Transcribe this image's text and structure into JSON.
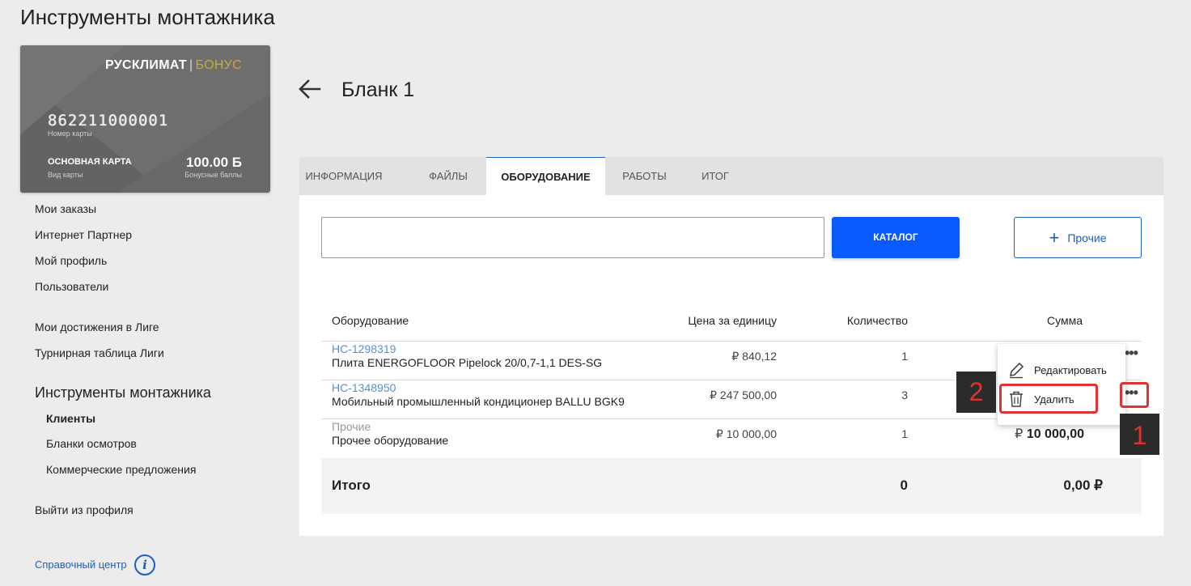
{
  "page_title": "Инструменты монтажника",
  "card": {
    "brand": "РУСКЛИМАТ",
    "brand_sep": "|",
    "brand_bonus": "БОНУС",
    "number": "862211000001",
    "number_label": "Номер карты",
    "type": "ОСНОВНАЯ КАРТА",
    "type_label": "Вид карты",
    "points": "100.00 Б",
    "points_label": "Бонусные баллы"
  },
  "sidebar": {
    "links": [
      "Мои заказы",
      "Интернет Партнер",
      "Мой профиль",
      "Пользователи",
      "Мои достижения в Лиге",
      "Турнирная таблица Лиги"
    ],
    "section_heading": "Инструменты монтажника",
    "sub_items": [
      "Клиенты",
      "Бланки осмотров",
      "Коммерческие предложения"
    ],
    "logout": "Выйти из профиля",
    "help": "Справочный центр",
    "help_icon": "i"
  },
  "header": {
    "title": "Бланк 1"
  },
  "tabs": [
    "ИНФОРМАЦИЯ",
    "ФАЙЛЫ",
    "ОБОРУДОВАНИЕ",
    "РАБОТЫ",
    "ИТОГ"
  ],
  "toolbar": {
    "search_value": "",
    "catalog_label": "КАТАЛОГ",
    "other_label": "Прочие",
    "other_icon": "+"
  },
  "table": {
    "headers": [
      "Оборудование",
      "Цена за единицу",
      "Количество",
      "Сумма"
    ],
    "rows": [
      {
        "code": "HC-1298319",
        "name": "Плита ENERGOFLOOR Pipelock 20/0,7-1,1 DES-SG",
        "price": "₽ 840,12",
        "qty": "1",
        "sum": ""
      },
      {
        "code": "HC-1348950",
        "name": "Мобильный промышленный кондиционер BALLU BGK9",
        "price": "₽ 247 500,00",
        "qty": "3",
        "sum": ""
      },
      {
        "code": "Прочие",
        "name": "Прочее оборудование",
        "price": "₽ 10 000,00",
        "qty": "1",
        "sum": "10 000,00",
        "sum_currency": "₽"
      }
    ],
    "row_menu_icon": "•••",
    "total": {
      "label": "Итого",
      "qty": "0",
      "sum": "0,00 ₽"
    }
  },
  "context_menu": {
    "edit": "Редактировать",
    "delete": "Удалить"
  },
  "annotations": {
    "step1": "1",
    "step2": "2"
  },
  "colors": {
    "primary": "#0a5bff",
    "link": "#1b5fc1",
    "highlight": "#e03232"
  }
}
